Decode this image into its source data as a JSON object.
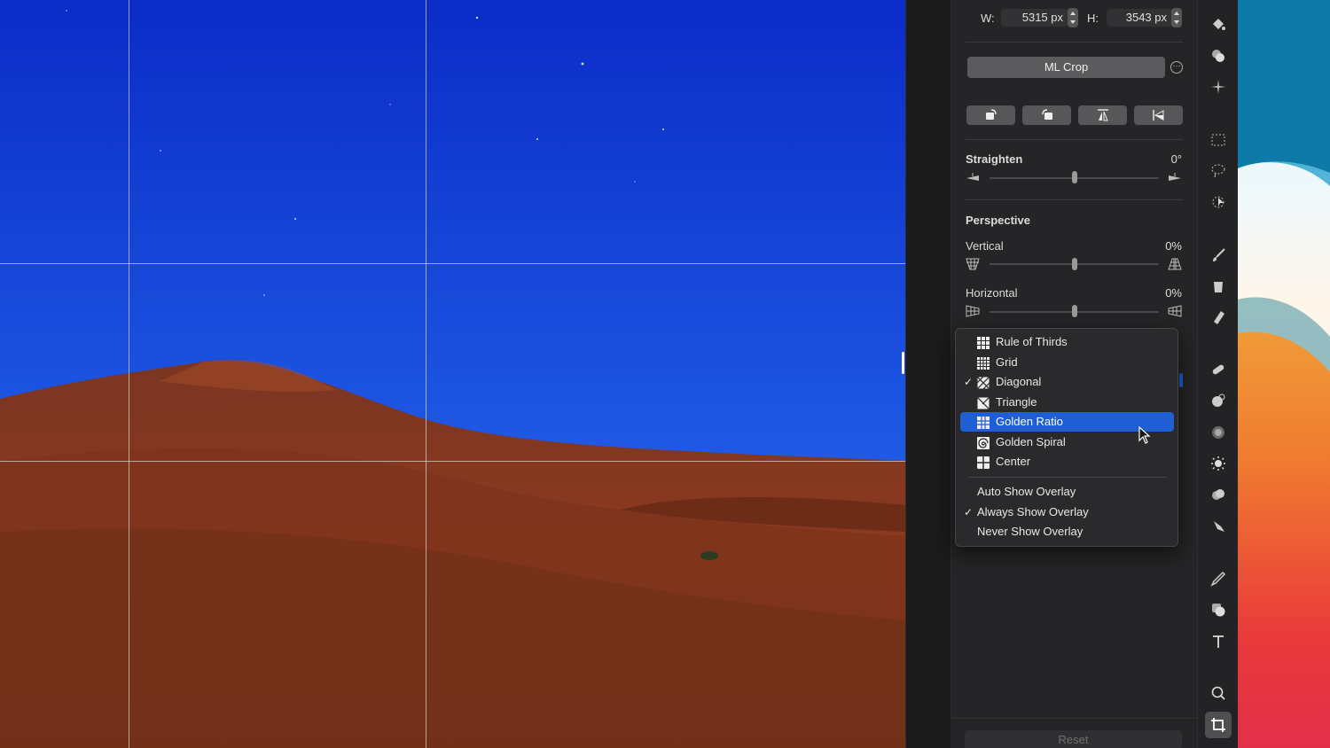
{
  "size": {
    "width_label": "W:",
    "width_value": "5315 px",
    "height_label": "H:",
    "height_value": "3543 px"
  },
  "ml_crop_label": "ML Crop",
  "straighten": {
    "label": "Straighten",
    "value": "0°",
    "level": 0.5
  },
  "perspective": {
    "label": "Perspective",
    "vertical": {
      "label": "Vertical",
      "value": "0%",
      "level": 0.5
    },
    "horizontal": {
      "label": "Horizontal",
      "value": "0%",
      "level": 0.5
    }
  },
  "overlay_menu": {
    "types": [
      {
        "label": "Rule of Thirds",
        "icon": "rule-of-thirds-icon",
        "checked": false,
        "selected": false
      },
      {
        "label": "Grid",
        "icon": "grid-icon",
        "checked": false,
        "selected": false
      },
      {
        "label": "Diagonal",
        "icon": "diagonal-icon",
        "checked": true,
        "selected": false
      },
      {
        "label": "Triangle",
        "icon": "triangle-icon",
        "checked": false,
        "selected": false
      },
      {
        "label": "Golden Ratio",
        "icon": "golden-ratio-icon",
        "checked": false,
        "selected": true
      },
      {
        "label": "Golden Spiral",
        "icon": "golden-spiral-icon",
        "checked": false,
        "selected": false
      },
      {
        "label": "Center",
        "icon": "center-icon",
        "checked": false,
        "selected": false
      }
    ],
    "modes": [
      {
        "label": "Auto Show Overlay",
        "checked": false
      },
      {
        "label": "Always Show Overlay",
        "checked": true
      },
      {
        "label": "Never Show Overlay",
        "checked": false
      }
    ]
  },
  "reset_label": "Reset",
  "colors": {
    "accent": "#1f5fd3",
    "sky_top": "#0a2fd0",
    "sky_bottom": "#2a62e8",
    "dune": "#8a3a1e"
  }
}
